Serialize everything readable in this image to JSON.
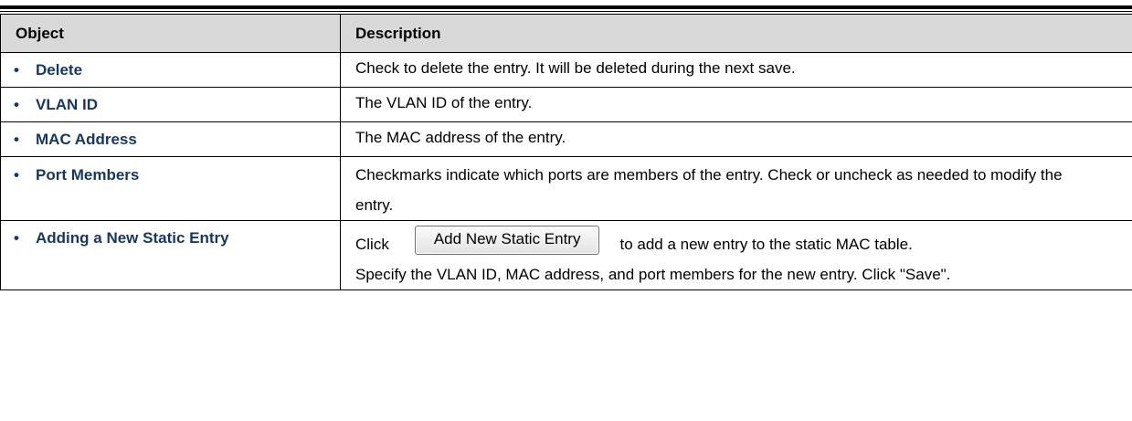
{
  "table": {
    "headers": {
      "object": "Object",
      "description": "Description"
    },
    "rows": [
      {
        "object": "Delete",
        "description": "Check to delete the entry. It will be deleted during the next save."
      },
      {
        "object": "VLAN ID",
        "description": "The VLAN ID of the entry."
      },
      {
        "object": "MAC Address",
        "description": "The MAC address of the entry."
      },
      {
        "object": "Port Members",
        "description": "Checkmarks indicate which ports are members of the entry. Check or uncheck as needed to modify the entry."
      },
      {
        "object": "Adding a New Static Entry",
        "description_prefix": "Click",
        "button_label": "Add New Static Entry",
        "description_suffix": "to add a new entry to the static MAC table.",
        "description_rest": "Specify the VLAN ID, MAC address, and port members for the new entry. Click \"Save\"."
      }
    ]
  },
  "colors": {
    "object_text": "#17375e",
    "header_bg": "#d9d9d9"
  }
}
